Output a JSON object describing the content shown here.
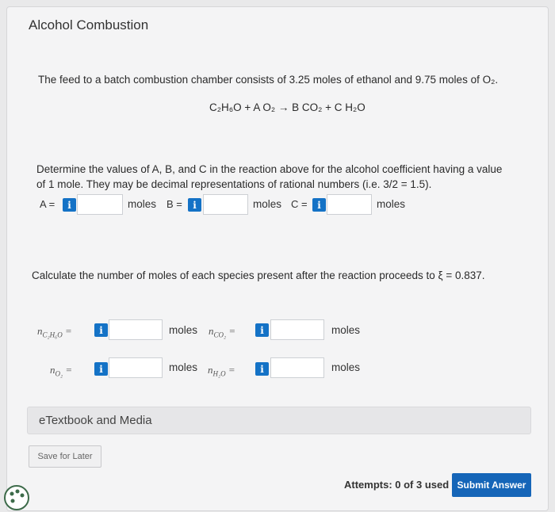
{
  "title": "Alcohol Combustion",
  "problem": {
    "feed_text": "The feed to a batch combustion chamber consists of 3.25 moles of ethanol and 9.75 moles of O₂.",
    "equation": "C₂H₆O + A O₂ → B CO₂ + C H₂O",
    "instruction": "Determine the values of A, B, and C in the reaction above for the alcohol coefficient having a value of 1 mole. They may be decimal representations of rational numbers (i.e. 3/2 = 1.5).",
    "part2": "Calculate the number of moles of each species present after the reaction proceeds to ξ = 0.837."
  },
  "coeffs": {
    "a_label": "A =",
    "b_label": "B =",
    "c_label": "C =",
    "unit": "moles",
    "a_value": "",
    "b_value": "",
    "c_value": ""
  },
  "species": {
    "n_c2h6o": "n",
    "n_c2h6o_sub": "C₂H₆O",
    "n_co2": "n",
    "n_co2_sub": "CO₂",
    "n_o2": "n",
    "n_o2_sub": "O₂",
    "n_h2o": "n",
    "n_h2o_sub": "H₂O",
    "eq": "=",
    "unit": "moles"
  },
  "info_glyph": "i",
  "etextbook": "eTextbook and Media",
  "save_later": "Save for Later",
  "attempts": "Attempts: 0 of 3 used",
  "submit": "Submit Answer",
  "colors": {
    "accent": "#1565b8",
    "info": "#1472c6"
  }
}
